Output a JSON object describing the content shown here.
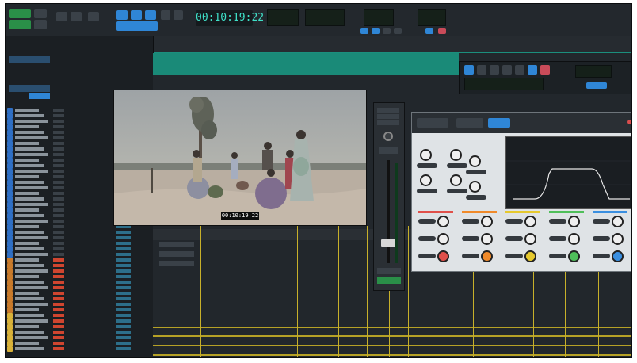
{
  "toolbar": {
    "main_counter": "00:10:19:22"
  },
  "video": {
    "timecode_overlay": "00:10:19:22"
  },
  "colors": {
    "background": "#1d2125",
    "accent_blue": "#2f86d6",
    "counter_teal": "#3fe0c8",
    "marker_yellow": "#c7b02a",
    "plugin_face": "#dfe3e6",
    "knob_ring_colors": [
      "#e0504a",
      "#f08a2a",
      "#e6c92e",
      "#4fbf5a",
      "#3a8fe0"
    ]
  },
  "icons": [
    "play-icon",
    "stop-icon",
    "rewind-icon",
    "fast-forward-icon",
    "record-icon",
    "loop-icon",
    "zoom-icon",
    "hand-tool-icon",
    "grabber-icon"
  ]
}
